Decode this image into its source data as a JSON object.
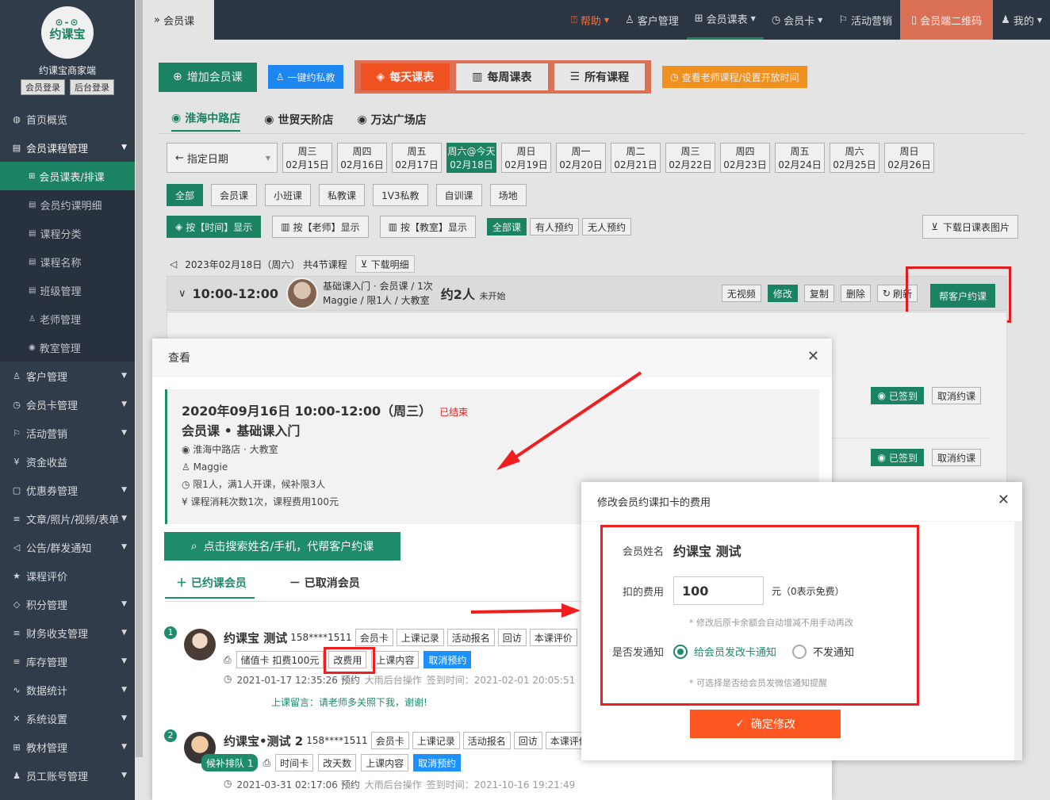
{
  "sidebar": {
    "logo_text": "约课宝",
    "logo_eyes": "⊙-⊙",
    "brand": "约课宝商家端",
    "login_member": "会员登录",
    "login_admin": "后台登录",
    "items": [
      {
        "label": "首页概览",
        "icon": "globe-icon"
      },
      {
        "label": "会员课程管理",
        "icon": "doc-icon"
      },
      {
        "label": "客户管理",
        "icon": "user-icon"
      },
      {
        "label": "会员卡管理",
        "icon": "clock-icon"
      },
      {
        "label": "活动营销",
        "icon": "flag-icon"
      },
      {
        "label": "资金收益",
        "icon": "yen-icon"
      },
      {
        "label": "优惠券管理",
        "icon": "doc-icon"
      },
      {
        "label": "文章/照片/视频/表单",
        "icon": "sliders-icon"
      },
      {
        "label": "公告/群发通知",
        "icon": "speaker-icon"
      },
      {
        "label": "课程评价",
        "icon": "star-icon"
      },
      {
        "label": "积分管理",
        "icon": "diamond-icon"
      },
      {
        "label": "财务收支管理",
        "icon": "sliders-icon"
      },
      {
        "label": "库存管理",
        "icon": "sliders-icon"
      },
      {
        "label": "数据统计",
        "icon": "pulse-icon"
      },
      {
        "label": "系统设置",
        "icon": "tools-icon"
      },
      {
        "label": "教材管理",
        "icon": "book-icon"
      },
      {
        "label": "员工账号管理",
        "icon": "person-icon"
      }
    ],
    "sub_items": [
      {
        "label": "会员课表/排课"
      },
      {
        "label": "会员约课明细"
      },
      {
        "label": "课程分类"
      },
      {
        "label": "课程名称"
      },
      {
        "label": "班级管理"
      },
      {
        "label": "老师管理"
      },
      {
        "label": "教室管理"
      }
    ]
  },
  "topbar": {
    "breadcrumb": "会员课",
    "nav": [
      "帮助",
      "客户管理",
      "会员课表",
      "会员卡",
      "活动营销",
      "会员端二维码",
      "我的"
    ]
  },
  "toolbar": {
    "add_course": "增加会员课",
    "one_click": "一键约私教",
    "daily": "每天课表",
    "weekly": "每周课表",
    "all": "所有课程",
    "teacher_view": "查看老师课程/设置开放时间"
  },
  "stores": [
    "淮海中路店",
    "世贸天阶店",
    "万达广场店"
  ],
  "date_picker": "指定日期",
  "dates": [
    {
      "day": "周三",
      "date": "02月15日"
    },
    {
      "day": "周四",
      "date": "02月16日"
    },
    {
      "day": "周五",
      "date": "02月17日"
    },
    {
      "day": "周六@今天",
      "date": "02月18日"
    },
    {
      "day": "周日",
      "date": "02月19日"
    },
    {
      "day": "周一",
      "date": "02月20日"
    },
    {
      "day": "周二",
      "date": "02月21日"
    },
    {
      "day": "周三",
      "date": "02月22日"
    },
    {
      "day": "周四",
      "date": "02月23日"
    },
    {
      "day": "周五",
      "date": "02月24日"
    },
    {
      "day": "周六",
      "date": "02月25日"
    },
    {
      "day": "周日",
      "date": "02月26日"
    }
  ],
  "filters": [
    "全部",
    "会员课",
    "小班课",
    "私教课",
    "1V3私教",
    "自训课",
    "场地"
  ],
  "display": {
    "by_time": "按【时间】显示",
    "by_teacher": "按【老师】显示",
    "by_room": "按【教室】显示",
    "all_courses": "全部课",
    "booked": "有人预约",
    "unbooked": "无人预约",
    "download_img": "下载日课表图片"
  },
  "summary": {
    "text": "2023年02月18日（周六） 共4节课程",
    "download": "下载明细"
  },
  "slot": {
    "time": "10:00-12:00",
    "line1": "基础课入门 · 会员课 / 1次",
    "line2": "Maggie / 限1人 / 大教室",
    "booked": "约2人",
    "status": "未开始",
    "actions": [
      "无视频",
      "修改",
      "复制",
      "删除",
      "刷新"
    ],
    "help_book": "帮客户约课",
    "signed": "已签到",
    "cancel": "取消约课"
  },
  "dialog1": {
    "title": "查看",
    "datetime": "2020年09月16日 10:00-12:00（周三）",
    "status": "已结束",
    "course": "会员课 • 基础课入门",
    "location": "淮海中路店 · 大教室",
    "teacher": "Maggie",
    "capacity": "限1人，满1人开课，候补限3人",
    "cost": "课程消耗次数1次，课程费用100元",
    "search_btn": "点击搜索姓名/手机，代帮客户约课",
    "tab_booked": "已约课会员",
    "tab_cancelled": "已取消会员",
    "members": [
      {
        "no": "1",
        "name": "约课宝 测试",
        "phone": "158****1511",
        "tags": [
          "会员卡",
          "上课记录",
          "活动报名",
          "回访",
          "本课评价"
        ],
        "card": "储值卡 扣费100元",
        "change_fee": "改费用",
        "content": "上课内容",
        "cancel": "取消预约",
        "booked_at": "2021-01-17 12:35:26 预约",
        "operator": "大雨后台操作",
        "signin": "签到时间：2021-02-01 20:05:51",
        "message": "上课留言：请老师多关照下我，谢谢!"
      },
      {
        "no": "2",
        "name": "约课宝•测试 2",
        "phone": "158****1511",
        "tags": [
          "会员卡",
          "上课记录",
          "活动报名",
          "回访",
          "本课评价"
        ],
        "waitlist": "候补排队 1",
        "card": "时间卡",
        "change_days": "改天数",
        "content": "上课内容",
        "cancel": "取消预约",
        "booked_at": "2021-03-31 02:17:06 预约",
        "operator": "大雨后台操作",
        "signin": "签到时间：2021-10-16 19:21:49"
      }
    ]
  },
  "dialog2": {
    "title": "修改会员约课扣卡的费用",
    "name_label": "会员姓名",
    "name_value": "约课宝 测试",
    "fee_label": "扣的费用",
    "fee_value": "100",
    "fee_unit": "元（0表示免费）",
    "fee_hint": "* 修改后原卡余额会自动增减不用手动再改",
    "notify_label": "是否发通知",
    "notify_yes": "给会员发改卡通知",
    "notify_no": "不发通知",
    "notify_hint": "* 可选择是否给会员发微信通知提醒",
    "confirm": "确定修改"
  }
}
